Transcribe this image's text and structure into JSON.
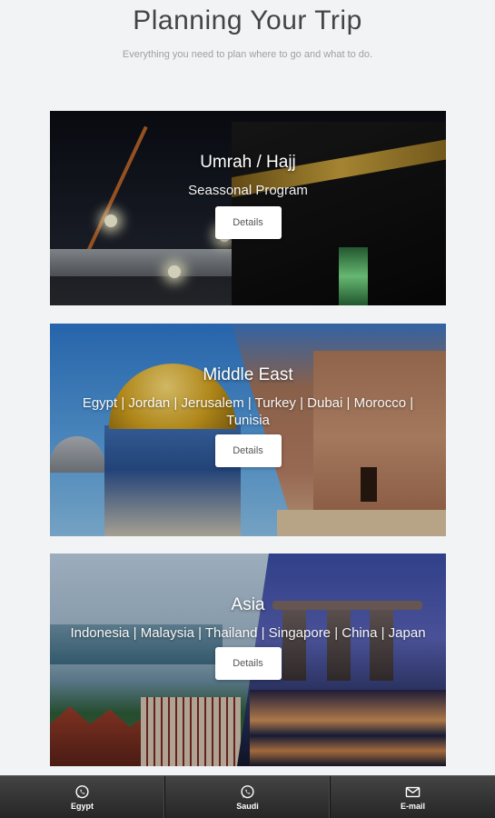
{
  "header": {
    "title": "Planning Your Trip",
    "subtitle": "Everything you need to plan where to go and what to do."
  },
  "cards": [
    {
      "title": "Umrah / Hajj",
      "subtitle": "Seassonal Program",
      "button": "Details"
    },
    {
      "title": "Middle East",
      "subtitle": "Egypt | Jordan | Jerusalem | Turkey | Dubai | Morocco | Tunisia",
      "button": "Details"
    },
    {
      "title": "Asia",
      "subtitle": "Indonesia | Malaysia | Thailand | Singapore | China | Japan",
      "button": "Details"
    }
  ],
  "bottom_nav": [
    {
      "label": "Egypt",
      "icon": "whatsapp-icon"
    },
    {
      "label": "Saudi",
      "icon": "whatsapp-icon"
    },
    {
      "label": "E-mail",
      "icon": "mail-icon"
    }
  ],
  "colors": {
    "background": "#f2f3f5",
    "bottom_bar": "#2e2e2e"
  }
}
